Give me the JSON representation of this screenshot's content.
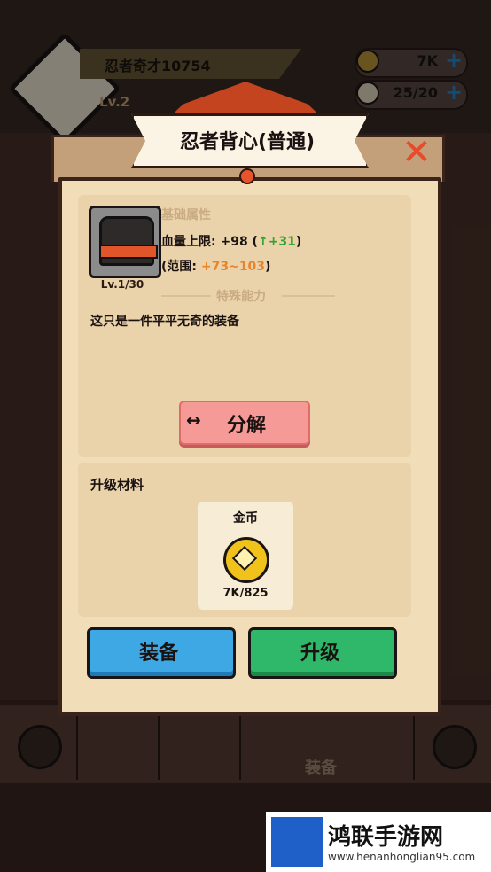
{
  "player": {
    "name": "忍者奇才10754",
    "level": "Lv.2"
  },
  "resources": [
    {
      "icon": "coin-icon",
      "value": "7K"
    },
    {
      "icon": "stamina-icon",
      "value": "25/20"
    }
  ],
  "panel": {
    "title": "忍者背心(普通)",
    "item": {
      "level": "Lv.1/30",
      "icon": "ninja-vest-icon"
    },
    "base_attr_label": "基础属性",
    "stat_hp_prefix": "血量上限: +98 (",
    "stat_hp_bonus": "+31",
    "stat_hp_suffix": ")",
    "stat_range_prefix": "(范围: ",
    "stat_range_value": "+73~103",
    "stat_range_suffix": ")",
    "special_label": "特殊能力",
    "description": "这只是一件平平无奇的装备",
    "decompose_label": "分解",
    "materials_title": "升级材料",
    "material": {
      "name": "金币",
      "count": "7K/825"
    },
    "equip_label": "装备",
    "upgrade_label": "升级"
  },
  "nav": {
    "equip_label": "装备"
  },
  "watermark": {
    "title": "鸿联手游网",
    "url": "www.henanhonglian95.com"
  },
  "colors": {
    "accent_red": "#e84a2c",
    "equip_blue": "#3ea8e4",
    "upgrade_green": "#2fb86a",
    "bonus_green": "#2ea32e"
  }
}
